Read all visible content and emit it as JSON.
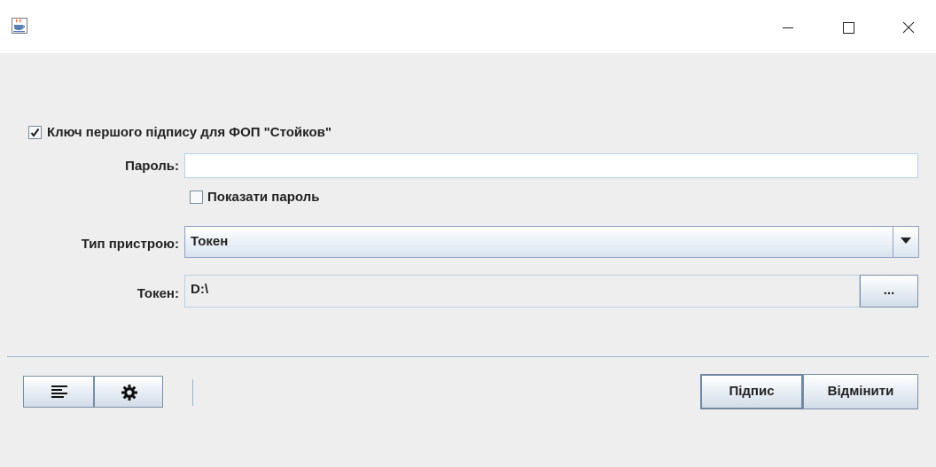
{
  "window": {
    "app_icon": "java-cup-icon",
    "controls": {
      "minimize": "minimize-icon",
      "maximize": "maximize-icon",
      "close": "close-icon"
    }
  },
  "form": {
    "key_checkbox_label": "Ключ першого підпису для ФОП \"Стойков\"",
    "key_checked": true,
    "password_label": "Пароль:",
    "password_value": "",
    "show_password_label": "Показати пароль",
    "show_password_checked": false,
    "device_type_label": "Тип пристрою:",
    "device_type_value": "Токен",
    "token_label": "Токен:",
    "token_value": "D:\\",
    "browse_label": "..."
  },
  "toolbar": {
    "left_buttons": [
      "list-icon",
      "gear-icon"
    ]
  },
  "actions": {
    "sign_label": "Підпис",
    "cancel_label": "Відмінити"
  }
}
